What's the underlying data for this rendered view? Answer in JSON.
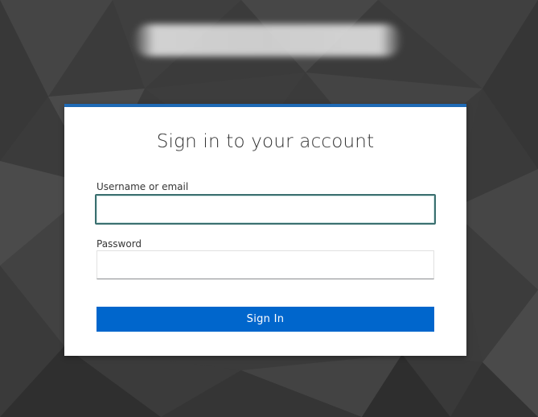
{
  "login": {
    "title": "Sign in to your account",
    "username_label": "Username or email",
    "username_value": "",
    "password_label": "Password",
    "password_value": "",
    "submit_label": "Sign In"
  },
  "colors": {
    "accent": "#0066cc",
    "card_top_border": "#1f6ab5",
    "background": "#3a3a3a"
  }
}
